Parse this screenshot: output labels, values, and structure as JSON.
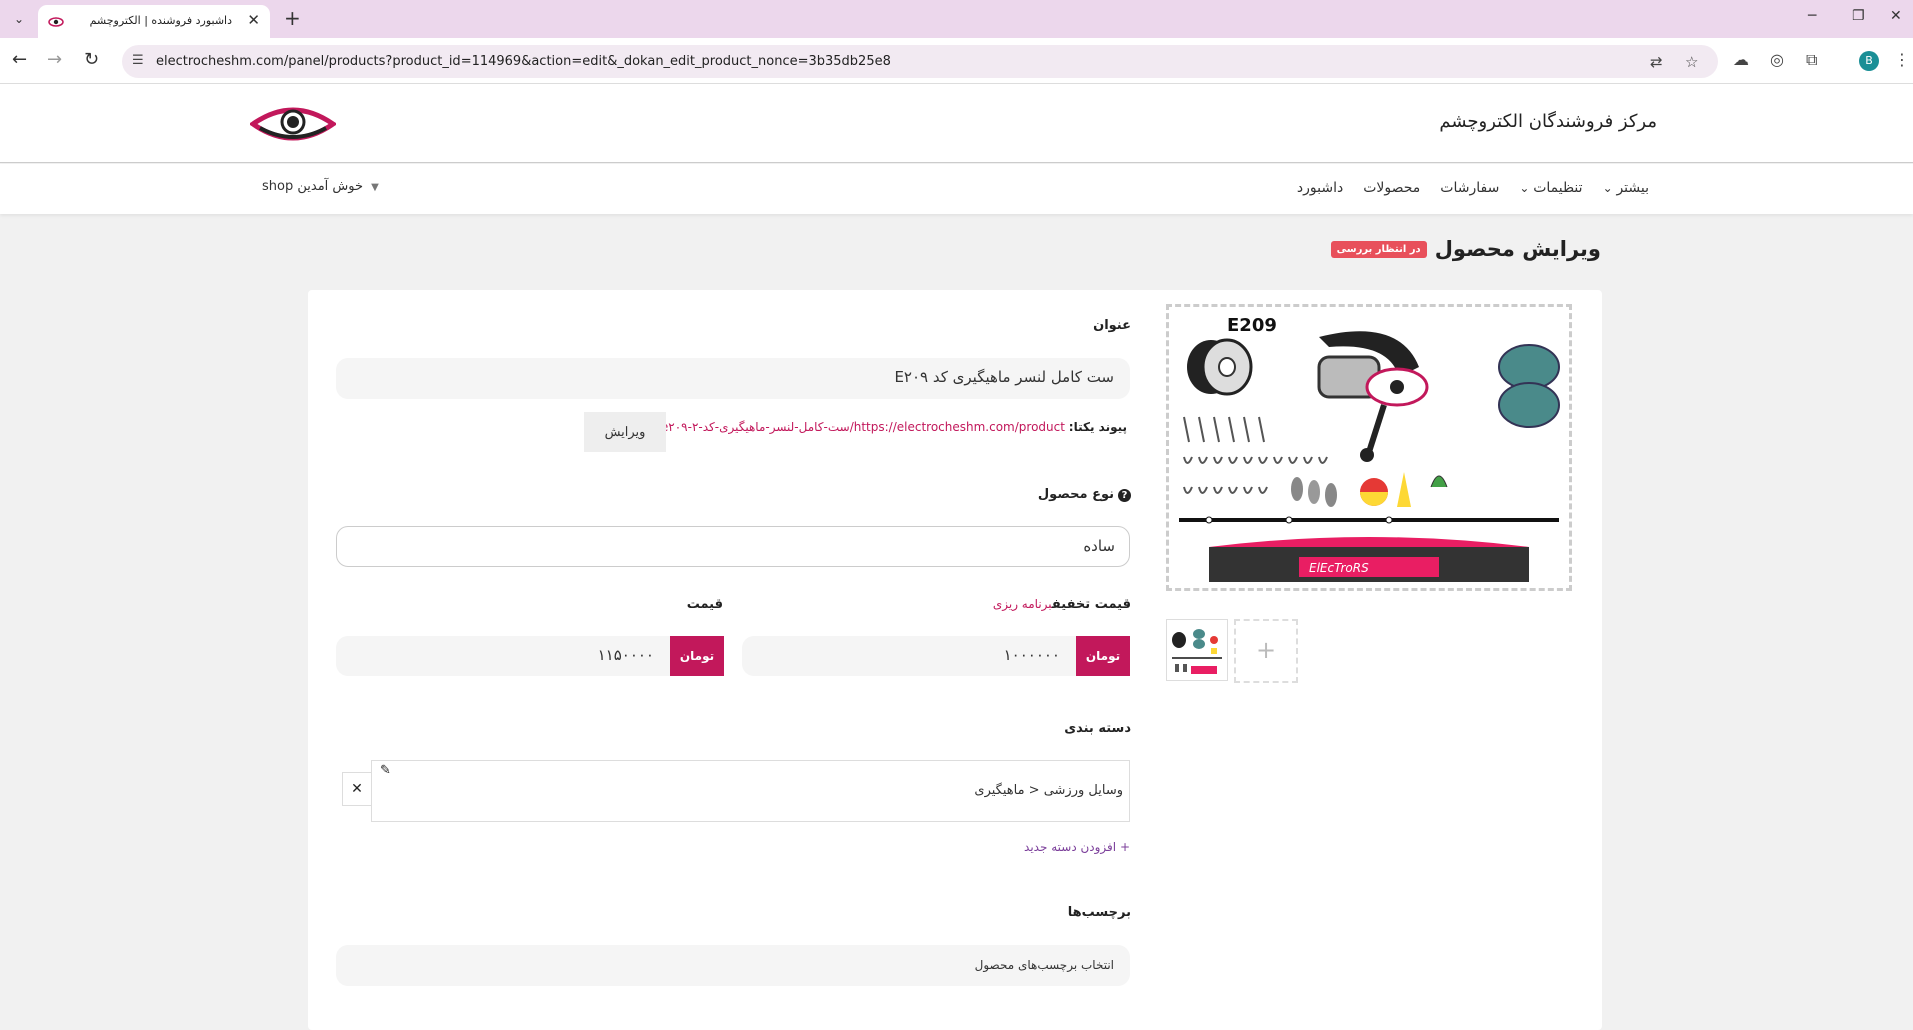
{
  "browser": {
    "tab_title": "داشبورد فروشنده | الکتروچشم",
    "url": "electrocheshm.com/panel/products?product_id=114969&action=edit&_dokan_edit_product_nonce=3b35db25e8",
    "profile_initial": "B"
  },
  "header": {
    "store_title": "مرکز فروشندگان الکتروچشم"
  },
  "nav": {
    "items": [
      {
        "label": "داشبورد"
      },
      {
        "label": "محصولات"
      },
      {
        "label": "سفارشات"
      },
      {
        "label": "تنظیمات"
      },
      {
        "label": "بیشتر"
      }
    ],
    "welcome": "خوش آمدین shop"
  },
  "page": {
    "title": "ویرایش محصول",
    "status_badge": "در انتظار بررسی"
  },
  "form": {
    "title_label": "عنوان",
    "title_value": "ست کامل لنسر ماهیگیری کد E۲۰۹",
    "permalink_label": "پیوند یکتا:",
    "permalink_url": "https://electrocheshm.com/product/ست-کامل-لنسر-ماهیگیری-کد-e۲۰۹-۲",
    "permalink_edit": "ویرایش",
    "product_type_label": "نوع محصول",
    "product_type_value": "ساده",
    "price_label": "قیمت",
    "price_value": "۱۱۵۰۰۰۰",
    "discount_label": "قیمت تخفیف",
    "schedule_link": "برنامه ریزی",
    "discount_value": "۱۰۰۰۰۰۰",
    "currency": "تومان",
    "category_label": "دسته بندی",
    "category_value": "وسایل ورزشی < ماهیگیری",
    "add_category": "+ افزودن دسته جدید",
    "tags_label": "برچسب‌ها",
    "tags_placeholder": "انتخاب برچسب‌های محصول"
  },
  "images": {
    "featured_code": "E209",
    "brand_mark": "ElEcTroRS"
  },
  "colors": {
    "accent": "#c2185b",
    "badge": "#e8505b",
    "tabstrip": "#ecd7ec"
  }
}
